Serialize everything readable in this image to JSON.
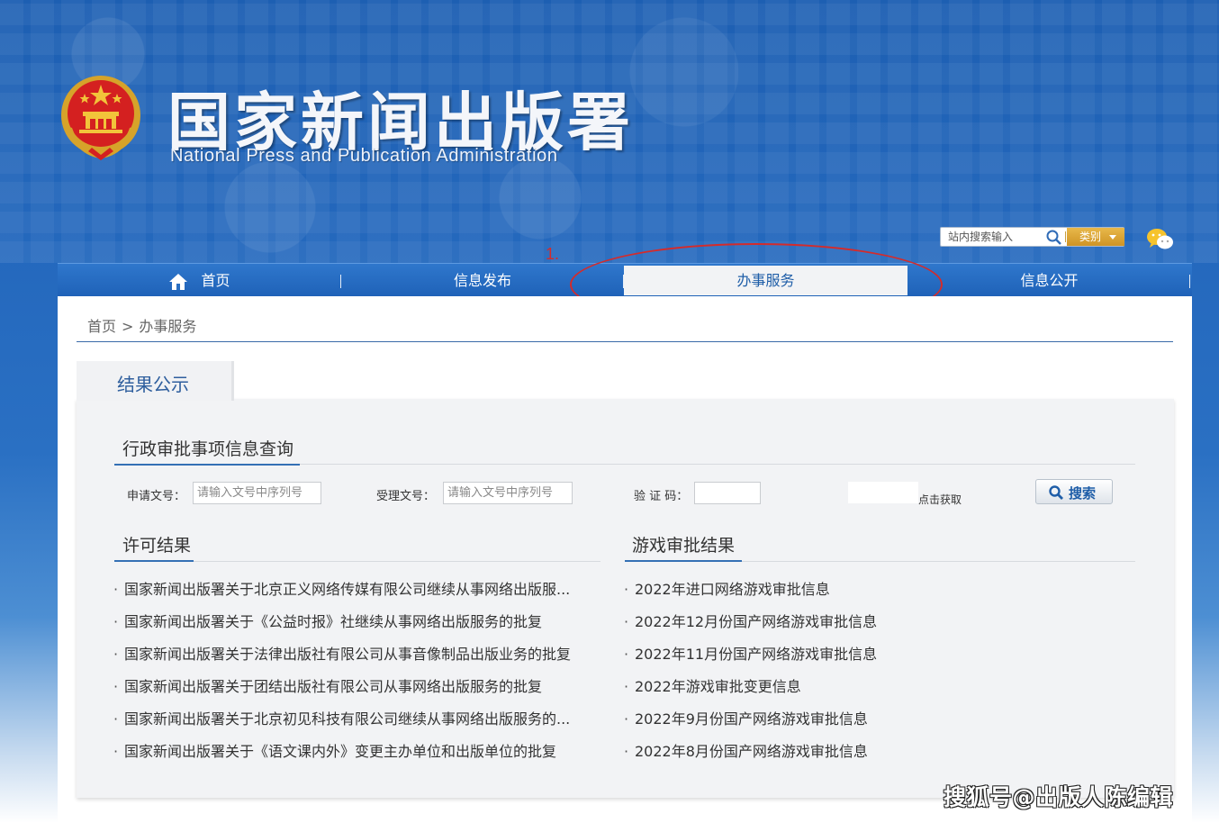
{
  "header": {
    "site_title": "国家新闻出版署",
    "site_subtitle": "National Press and Publication Administration",
    "emblem_icon": "national-emblem-icon"
  },
  "search": {
    "placeholder": "站内搜索输入",
    "category_label": "类别",
    "icon": "search-icon"
  },
  "nav": {
    "home_icon": "home-icon",
    "items": [
      {
        "label": "首页"
      },
      {
        "label": "信息发布"
      },
      {
        "label": "办事服务",
        "active": true
      },
      {
        "label": "信息公开"
      }
    ]
  },
  "annotation": {
    "number": "1.",
    "color": "#d42b2b"
  },
  "breadcrumb": {
    "home": "首页",
    "separator": ">",
    "current": "办事服务"
  },
  "tab": {
    "label": "结果公示"
  },
  "query": {
    "title": "行政审批事项信息查询",
    "apply_no_label": "申请文号：",
    "apply_no_placeholder": "请输入文号中序列号",
    "accept_no_label": "受理文号：",
    "accept_no_placeholder": "请输入文号中序列号",
    "captcha_label": "验 证 码：",
    "captcha_link": "点击获取",
    "search_button": "搜索"
  },
  "license": {
    "title": "许可结果",
    "items": [
      "国家新闻出版署关于北京正义网络传媒有限公司继续从事网络出版服...",
      "国家新闻出版署关于《公益时报》社继续从事网络出版服务的批复",
      "国家新闻出版署关于法律出版社有限公司从事音像制品出版业务的批复",
      "国家新闻出版署关于团结出版社有限公司从事网络出版服务的批复",
      "国家新闻出版署关于北京初见科技有限公司继续从事网络出版服务的...",
      "国家新闻出版署关于《语文课内外》变更主办单位和出版单位的批复"
    ]
  },
  "games": {
    "title": "游戏审批结果",
    "items": [
      "2022年进口网络游戏审批信息",
      "2022年12月份国产网络游戏审批信息",
      "2022年11月份国产网络游戏审批信息",
      "2022年游戏审批变更信息",
      "2022年9月份国产网络游戏审批信息",
      "2022年8月份国产网络游戏审批信息"
    ]
  },
  "watermark": "搜狐号@出版人陈编辑",
  "colors": {
    "nav_bg": "#1f62b8",
    "accent": "#3470b5",
    "category_button": "#cf9425"
  }
}
